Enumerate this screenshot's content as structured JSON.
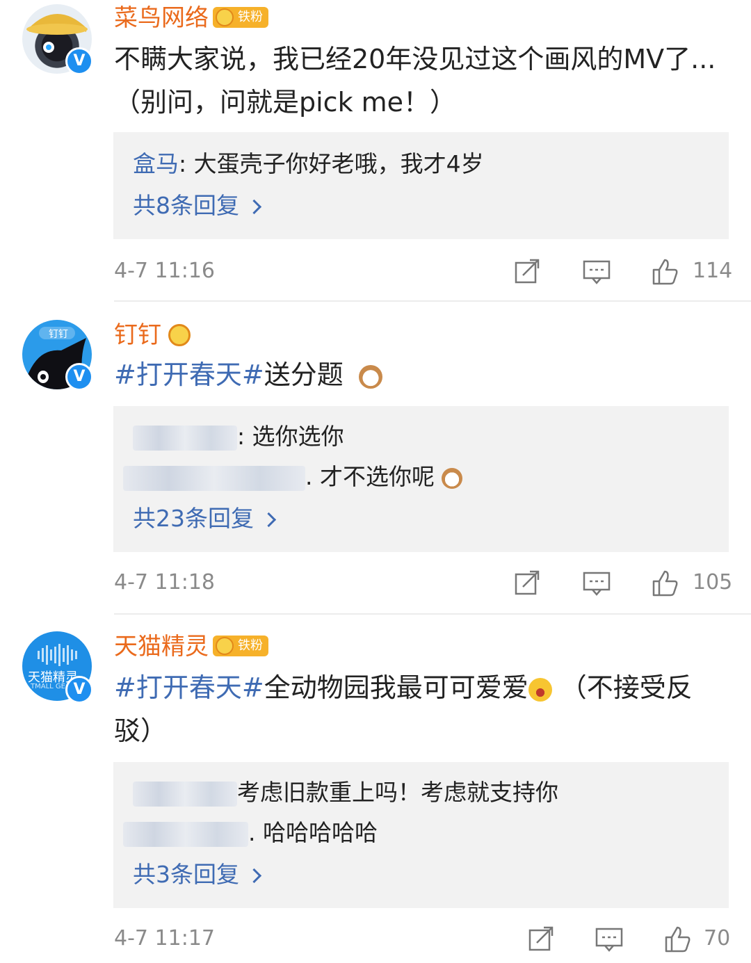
{
  "comments": [
    {
      "username": "菜鸟网络",
      "badge": "铁粉",
      "content": "不瞒大家说，我已经20年没见过这个画风的MV了...（别问，问就是pick me！）",
      "reply_preview_user": "盒马",
      "reply_preview_text": ": 大蛋壳子你好老哦，我才4岁",
      "more_replies": "共8条回复",
      "time": "4-7 11:16",
      "likes": "114",
      "avatar_color": "#2a86d6"
    },
    {
      "username": "钉钉",
      "topic": "#打开春天#",
      "content": "送分题",
      "reply_line1": ": 选你选你",
      "reply_line2": ". 才不选你呢",
      "more_replies": "共23条回复",
      "time": "4-7 11:18",
      "likes": "105",
      "avatar_color": "#2b9bea",
      "avatar_text": "钉钉"
    },
    {
      "username": "天猫精灵",
      "badge": "铁粉",
      "topic": "#打开春天#",
      "content": "全动物园我最可可爱爱",
      "content_tail": " （不接受反驳）",
      "reply_line1": "考虑旧款重上吗！考虑就支持你",
      "reply_line2": ". 哈哈哈哈哈",
      "more_replies": "共3条回复",
      "time": "4-7 11:17",
      "likes": "70",
      "avatar_color": "#1f8fe6",
      "avatar_text": "天猫精灵",
      "avatar_subtext": "TMALL GE"
    }
  ],
  "icons": {
    "verify": "V",
    "share": "share-icon",
    "comment": "comment-icon",
    "like": "like-icon"
  }
}
